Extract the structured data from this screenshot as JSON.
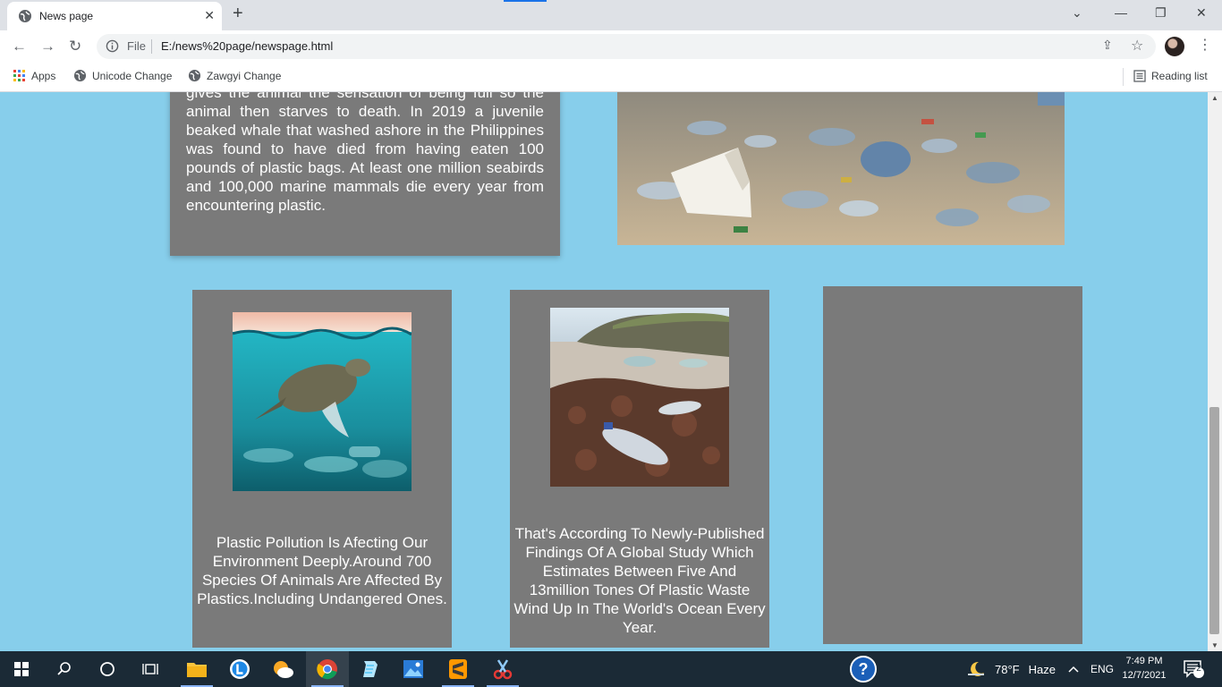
{
  "browser": {
    "tab_title": "News page",
    "address_scheme": "File",
    "address_url": "E:/news%20page/newspage.html",
    "bookmarks": [
      "Apps",
      "Unicode Change",
      "Zawgyi Change"
    ],
    "reading_list": "Reading list"
  },
  "article": {
    "top_card_text": "gives the animal the sensation of being full so the animal then starves to death. In 2019 a juvenile beaked whale that washed ashore in the Philippines was found to have died from having eaten 100 pounds of plastic bags. At least one million seabirds and 100,000 marine mammals die every year from encountering plastic.",
    "card_a_caption": "Plastic Pollution Is Afecting Our Environment Deeply.Around 700 Species Of Animals Are Affected By Plastics.Including Undangered Ones.",
    "card_b_caption": "That's According To Newly-Published Findings Of A Global Study Which Estimates Between Five And 13million Tones Of Plastic Waste Wind Up In The World's Ocean Every Year."
  },
  "taskbar": {
    "weather_temp": "78°F",
    "weather_desc": "Haze",
    "language": "ENG",
    "time": "7:49 PM",
    "date": "12/7/2021",
    "notifications": "2"
  },
  "colors": {
    "page_background": "#87ceeb",
    "card_background": "#7a7a7a",
    "taskbar": "#1b2a36"
  }
}
